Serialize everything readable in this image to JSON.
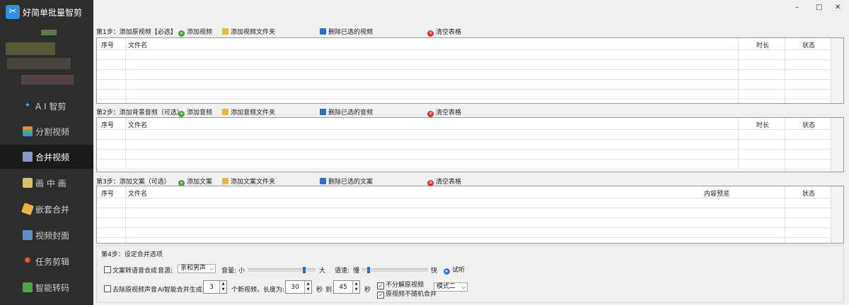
{
  "app": {
    "title": "好简单批量智剪"
  },
  "sidebar": {
    "items": [
      {
        "label": "A I 智剪",
        "icon": "ai-wand-icon"
      },
      {
        "label": "分割视频",
        "icon": "split-icon"
      },
      {
        "label": "合并视频",
        "icon": "merge-icon",
        "active": true
      },
      {
        "label": "画 中 画",
        "icon": "pip-icon"
      },
      {
        "label": "嵌套合并",
        "icon": "nest-icon"
      },
      {
        "label": "视频封面",
        "icon": "cover-icon"
      },
      {
        "label": "任务剪辑",
        "icon": "task-icon"
      },
      {
        "label": "智能转码",
        "icon": "transcode-icon"
      }
    ]
  },
  "window": {
    "minimize": "–",
    "maximize": "□",
    "close": "✕"
  },
  "step1": {
    "label": "第1步：添加原视频【必选】",
    "add": "添加视频",
    "add_folder": "添加视频文件夹",
    "delete": "删除已选的视频",
    "clear": "清空表格",
    "headers": {
      "index": "序号",
      "name": "文件名",
      "duration": "时长",
      "status": "状态"
    }
  },
  "step2": {
    "label": "第2步：添加背景音频（可选）",
    "add": "添加音频",
    "add_folder": "添加音频文件夹",
    "delete": "删除已选的音频",
    "clear": "清空表格",
    "headers": {
      "index": "序号",
      "name": "文件名",
      "duration": "时长",
      "status": "状态"
    }
  },
  "step3": {
    "label": "第3步：添加文案（可选）",
    "add": "添加文案",
    "add_folder": "添加文案文件夹",
    "delete": "删除已选的文案",
    "clear": "清空表格",
    "headers": {
      "index": "序号",
      "name": "文件名",
      "preview": "内容预览",
      "status": "状态"
    }
  },
  "step4": {
    "label": "第4步：设定合并选项",
    "tts_label": "文案转语音合成",
    "tts_checked": false,
    "voice_label": "音源:",
    "voice_value": "亲和男声",
    "volume_label": "音量:",
    "volume_min": "小",
    "volume_max": "大",
    "volume_level": 0.85,
    "speed_label": "语速:",
    "speed_min": "慢",
    "speed_max": "快",
    "speed_level": 0.08,
    "listen_label": "试听",
    "remove_audio_label": "去除原视频声音",
    "remove_audio_checked": false,
    "ai_gen_label": "AI智能合并生成:",
    "count_value": "3",
    "new_videos_label": "个新视频，长度为:",
    "len_min": "30",
    "sec_label": "秒",
    "to_label": "到",
    "len_max": "45",
    "sec_label2": "秒",
    "no_split_label": "不分解原视频",
    "no_split_checked": true,
    "no_random_label": "原视频不随机合并",
    "no_random_checked": true,
    "mode_value": "模式二"
  }
}
